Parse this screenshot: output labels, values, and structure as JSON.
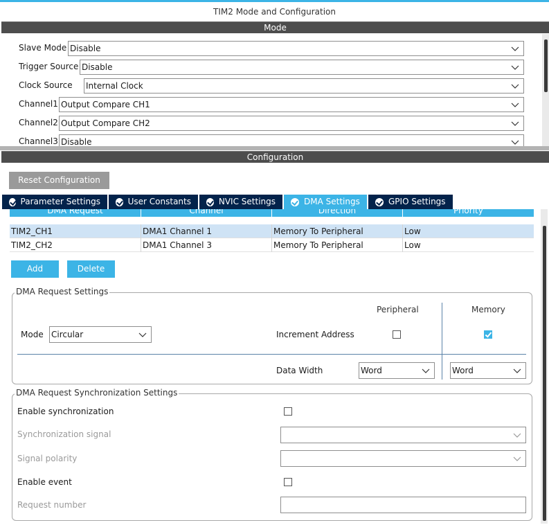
{
  "window": {
    "title": "TIM2 Mode and Configuration"
  },
  "sections": {
    "mode": "Mode",
    "configuration": "Configuration"
  },
  "mode_fields": [
    {
      "label": "Slave Mode",
      "value": "Disable"
    },
    {
      "label": "Trigger Source",
      "value": "Disable"
    },
    {
      "label": "Clock Source",
      "value": "Internal Clock"
    },
    {
      "label": "Channel1",
      "value": "Output Compare CH1"
    },
    {
      "label": "Channel2",
      "value": "Output Compare CH2"
    },
    {
      "label": "Channel3",
      "value": "Disable"
    }
  ],
  "reset_button": "Reset Configuration",
  "tabs": [
    {
      "label": "Parameter Settings",
      "active": false
    },
    {
      "label": "User Constants",
      "active": false
    },
    {
      "label": "NVIC Settings",
      "active": false
    },
    {
      "label": "DMA Settings",
      "active": true
    },
    {
      "label": "GPIO Settings",
      "active": false
    }
  ],
  "dma_table": {
    "columns": [
      "DMA Request",
      "Channel",
      "Direction",
      "Priority"
    ],
    "rows": [
      {
        "request": "TIM2_CH1",
        "channel": "DMA1 Channel 1",
        "direction": "Memory To Peripheral",
        "priority": "Low",
        "selected": true
      },
      {
        "request": "TIM2_CH2",
        "channel": "DMA1 Channel 3",
        "direction": "Memory To Peripheral",
        "priority": "Low",
        "selected": false
      }
    ]
  },
  "buttons": {
    "add": "Add",
    "delete": "Delete"
  },
  "dma_request_settings": {
    "title": "DMA Request Settings",
    "peripheral_header": "Peripheral",
    "memory_header": "Memory",
    "mode_label": "Mode",
    "mode_value": "Circular",
    "increment_label": "Increment Address",
    "peripheral_increment": false,
    "memory_increment": true,
    "data_width_label": "Data Width",
    "peripheral_width": "Word",
    "memory_width": "Word"
  },
  "sync_settings": {
    "title": "DMA Request Synchronization Settings",
    "enable_sync_label": "Enable synchronization",
    "enable_sync": false,
    "sync_signal_label": "Synchronization signal",
    "sync_signal_value": "",
    "signal_polarity_label": "Signal polarity",
    "signal_polarity_value": "",
    "enable_event_label": "Enable event",
    "enable_event": false,
    "request_number_label": "Request number",
    "request_number_value": ""
  },
  "colors": {
    "accent": "#3cb4e6",
    "tab_dark": "#03234b",
    "section_bar": "#4d4d4d"
  }
}
